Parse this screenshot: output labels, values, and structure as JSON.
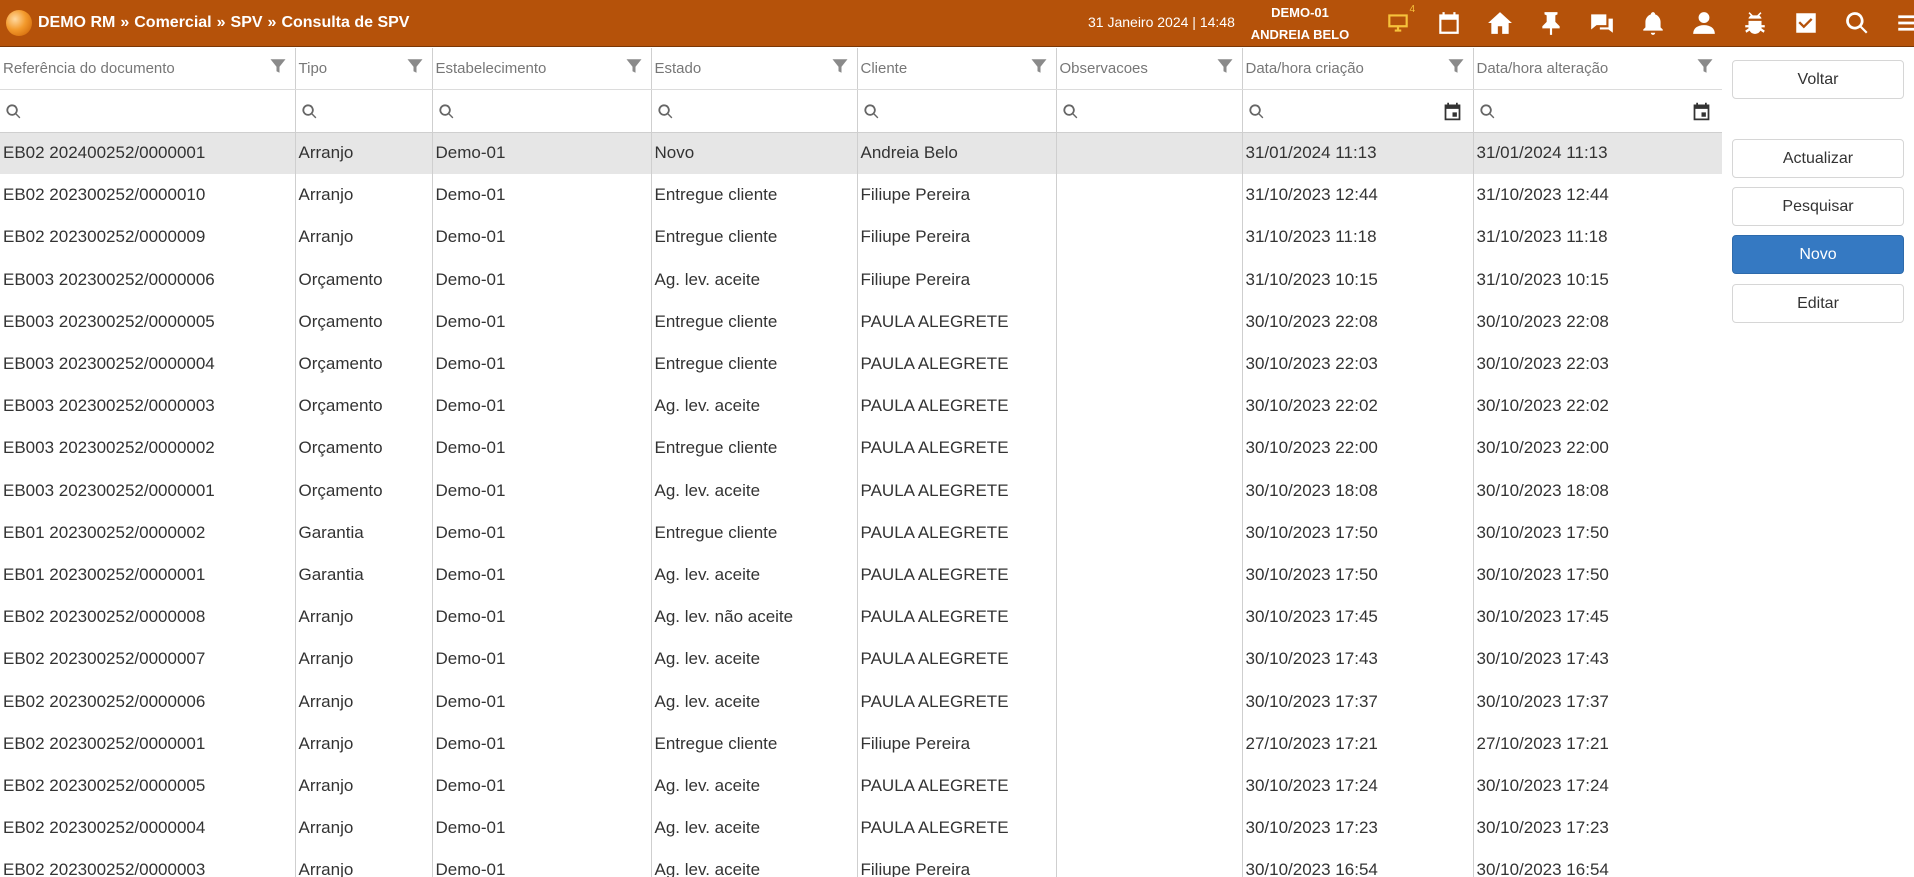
{
  "header": {
    "breadcrumb": [
      "DEMO RM",
      "Comercial",
      "SPV",
      "Consulta de SPV"
    ],
    "separator": "»",
    "datetime": "31 Janeiro 2024 | 14:48",
    "workspace": "DEMO-01",
    "user": "ANDREIA BELO",
    "monitor_badge": "4",
    "icons": [
      "monitor-icon",
      "calendar-icon",
      "home-icon",
      "pin-icon",
      "chat-icon",
      "bell-icon",
      "user-icon",
      "bug-icon",
      "checkbox-icon",
      "search-icon",
      "menu-icon"
    ]
  },
  "table": {
    "columns": [
      "Referência do documento",
      "Tipo",
      "Estabelecimento",
      "Estado",
      "Cliente",
      "Observacoes",
      "Data/hora criação",
      "Data/hora alteração"
    ],
    "rows": [
      [
        "EB02 202400252/0000001",
        "Arranjo",
        "Demo-01",
        "Novo",
        "Andreia Belo",
        "",
        "31/01/2024 11:13",
        "31/01/2024 11:13"
      ],
      [
        "EB02 202300252/0000010",
        "Arranjo",
        "Demo-01",
        "Entregue cliente",
        "Filiupe Pereira",
        "",
        "31/10/2023 12:44",
        "31/10/2023 12:44"
      ],
      [
        "EB02 202300252/0000009",
        "Arranjo",
        "Demo-01",
        "Entregue cliente",
        "Filiupe Pereira",
        "",
        "31/10/2023 11:18",
        "31/10/2023 11:18"
      ],
      [
        "EB003 202300252/0000006",
        "Orçamento",
        "Demo-01",
        "Ag. lev. aceite",
        "Filiupe Pereira",
        "",
        "31/10/2023 10:15",
        "31/10/2023 10:15"
      ],
      [
        "EB003 202300252/0000005",
        "Orçamento",
        "Demo-01",
        "Entregue cliente",
        "PAULA ALEGRETE",
        "",
        "30/10/2023 22:08",
        "30/10/2023 22:08"
      ],
      [
        "EB003 202300252/0000004",
        "Orçamento",
        "Demo-01",
        "Entregue cliente",
        "PAULA ALEGRETE",
        "",
        "30/10/2023 22:03",
        "30/10/2023 22:03"
      ],
      [
        "EB003 202300252/0000003",
        "Orçamento",
        "Demo-01",
        "Ag. lev. aceite",
        "PAULA ALEGRETE",
        "",
        "30/10/2023 22:02",
        "30/10/2023 22:02"
      ],
      [
        "EB003 202300252/0000002",
        "Orçamento",
        "Demo-01",
        "Entregue cliente",
        "PAULA ALEGRETE",
        "",
        "30/10/2023 22:00",
        "30/10/2023 22:00"
      ],
      [
        "EB003 202300252/0000001",
        "Orçamento",
        "Demo-01",
        "Ag. lev. aceite",
        "PAULA ALEGRETE",
        "",
        "30/10/2023 18:08",
        "30/10/2023 18:08"
      ],
      [
        "EB01 202300252/0000002",
        "Garantia",
        "Demo-01",
        "Entregue cliente",
        "PAULA ALEGRETE",
        "",
        "30/10/2023 17:50",
        "30/10/2023 17:50"
      ],
      [
        "EB01 202300252/0000001",
        "Garantia",
        "Demo-01",
        "Ag. lev. aceite",
        "PAULA ALEGRETE",
        "",
        "30/10/2023 17:50",
        "30/10/2023 17:50"
      ],
      [
        "EB02 202300252/0000008",
        "Arranjo",
        "Demo-01",
        "Ag. lev. não aceite",
        "PAULA ALEGRETE",
        "",
        "30/10/2023 17:45",
        "30/10/2023 17:45"
      ],
      [
        "EB02 202300252/0000007",
        "Arranjo",
        "Demo-01",
        "Ag. lev. aceite",
        "PAULA ALEGRETE",
        "",
        "30/10/2023 17:43",
        "30/10/2023 17:43"
      ],
      [
        "EB02 202300252/0000006",
        "Arranjo",
        "Demo-01",
        "Ag. lev. aceite",
        "PAULA ALEGRETE",
        "",
        "30/10/2023 17:37",
        "30/10/2023 17:37"
      ],
      [
        "EB02 202300252/0000001",
        "Arranjo",
        "Demo-01",
        "Entregue cliente",
        "Filiupe Pereira",
        "",
        "27/10/2023 17:21",
        "27/10/2023 17:21"
      ],
      [
        "EB02 202300252/0000005",
        "Arranjo",
        "Demo-01",
        "Ag. lev. aceite",
        "PAULA ALEGRETE",
        "",
        "30/10/2023 17:24",
        "30/10/2023 17:24"
      ],
      [
        "EB02 202300252/0000004",
        "Arranjo",
        "Demo-01",
        "Ag. lev. aceite",
        "PAULA ALEGRETE",
        "",
        "30/10/2023 17:23",
        "30/10/2023 17:23"
      ],
      [
        "EB02 202300252/0000003",
        "Arranjo",
        "Demo-01",
        "Ag. lev. aceite",
        "Filiupe Pereira",
        "",
        "30/10/2023 16:54",
        "30/10/2023 16:54"
      ]
    ]
  },
  "buttons": {
    "back": "Voltar",
    "refresh": "Actualizar",
    "search": "Pesquisar",
    "new": "Novo",
    "edit": "Editar"
  },
  "colors": {
    "topbar": "#b5520a",
    "primary_button": "#3579c2",
    "selected_row": "#e6e6e6",
    "monitor_icon": "#f6c23b"
  }
}
